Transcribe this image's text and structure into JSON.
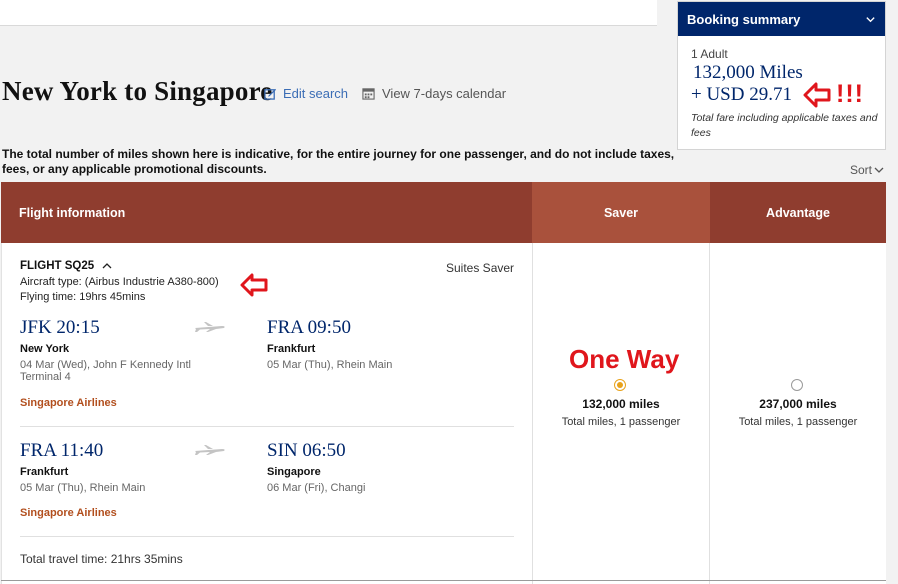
{
  "header": {
    "route_title": "New York to Singapore",
    "edit_search": "Edit search",
    "view_calendar": "View 7-days calendar"
  },
  "disclaimer": "The total number of miles shown here is indicative, for the entire journey for one passenger, and do not include taxes, fees, or any applicable promotional discounts.",
  "booking_summary": {
    "title": "Booking summary",
    "passengers": "1 Adult",
    "miles": "132,000 Miles",
    "usd": "+ USD 29.71",
    "note": "Total fare including applicable taxes and fees"
  },
  "annotations": {
    "exclaim": "!!!",
    "one_way": "One Way",
    "color": "#e0161c"
  },
  "sort_label": "Sort",
  "table": {
    "col_flight": "Flight information",
    "col_saver": "Saver",
    "col_advantage": "Advantage"
  },
  "flight": {
    "number": "FLIGHT SQ25",
    "cabin": "Suites Saver",
    "aircraft": "Aircraft type: (Airbus Industrie A380-800)",
    "flying_time": "Flying time: 19hrs 45mins",
    "segments": [
      {
        "dep_time": "JFK 20:15",
        "dep_city": "New York",
        "dep_detail": "04 Mar (Wed), John F Kennedy Intl",
        "dep_terminal": "Terminal 4",
        "arr_time": "FRA 09:50",
        "arr_city": "Frankfurt",
        "arr_detail": "05 Mar (Thu), Rhein Main",
        "airline": "Singapore Airlines"
      },
      {
        "dep_time": "FRA 11:40",
        "dep_city": "Frankfurt",
        "dep_detail": "05 Mar (Thu), Rhein Main",
        "arr_time": "SIN 06:50",
        "arr_city": "Singapore",
        "arr_detail": "06 Mar (Fri), Changi",
        "airline": "Singapore Airlines"
      }
    ],
    "total_travel_time": "Total travel time: 21hrs 35mins"
  },
  "fares": {
    "saver": {
      "miles": "132,000 miles",
      "sub": "Total miles, 1 passenger",
      "selected": true
    },
    "advantage": {
      "miles": "237,000 miles",
      "sub": "Total miles, 1 passenger",
      "selected": false
    }
  },
  "colors": {
    "brand_navy": "#00266b",
    "header_brown": "#8f3d2f",
    "saver_brown": "#a9513c",
    "airline_orange": "#b24f1e",
    "radio_selected": "#e8a21a"
  }
}
